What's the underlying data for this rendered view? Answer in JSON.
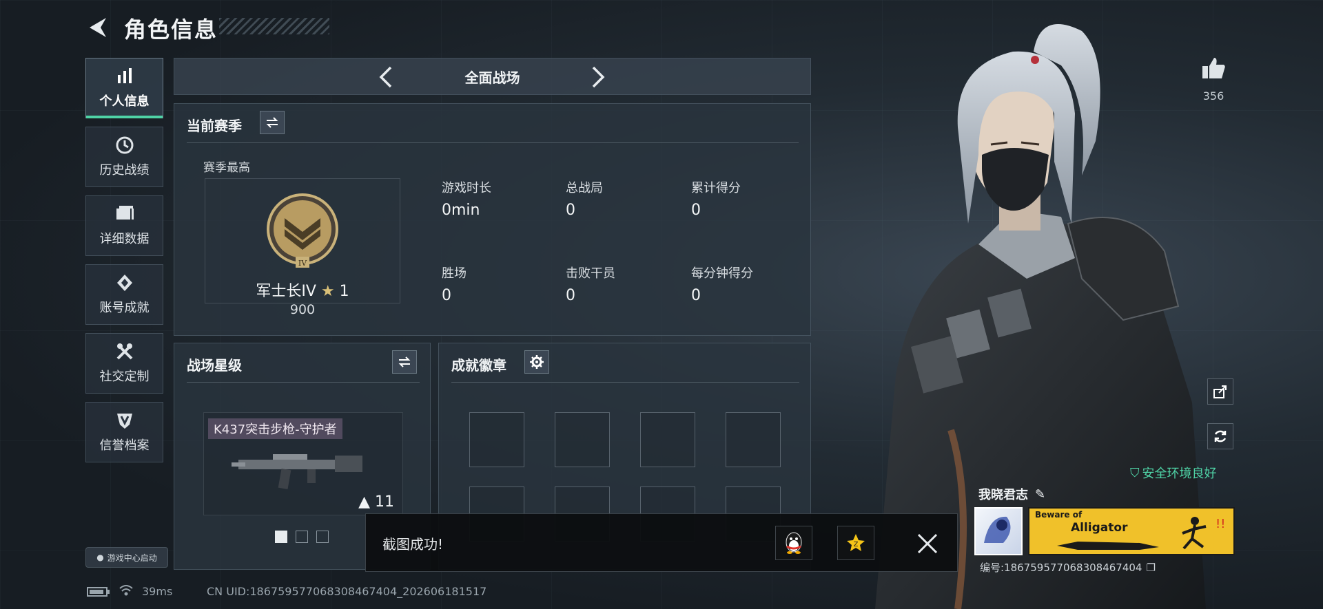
{
  "header": {
    "title": "角色信息"
  },
  "sidebar": {
    "items": [
      {
        "label": "个人信息",
        "icon": "bar-chart-icon",
        "active": true
      },
      {
        "label": "历史战绩",
        "icon": "history-icon",
        "active": false
      },
      {
        "label": "详细数据",
        "icon": "folder-icon",
        "active": false
      },
      {
        "label": "账号成就",
        "icon": "achievement-icon",
        "active": false
      },
      {
        "label": "社交定制",
        "icon": "tools-icon",
        "active": false
      },
      {
        "label": "信誉档案",
        "icon": "shield-icon",
        "active": false
      }
    ],
    "launch_label": "游戏中心启动"
  },
  "mode": {
    "title": "全面战场"
  },
  "season": {
    "title": "当前赛季",
    "best_label": "赛季最高",
    "rank_name": "军士长IV",
    "rank_stars": "1",
    "rank_points": "900",
    "stats": [
      {
        "label": "游戏时长",
        "value": "0min"
      },
      {
        "label": "总战局",
        "value": "0"
      },
      {
        "label": "累计得分",
        "value": "0"
      },
      {
        "label": "胜场",
        "value": "0"
      },
      {
        "label": "击败干员",
        "value": "0"
      },
      {
        "label": "每分钟得分",
        "value": "0"
      }
    ]
  },
  "star_level": {
    "title": "战场星级",
    "weapon_name": "K437突击步枪-守护者",
    "weapon_level": "11"
  },
  "badges": {
    "title": "成就徽章"
  },
  "toast": {
    "text": "截图成功!"
  },
  "status": {
    "ping": "39ms",
    "uid": "CN UID:186759577068308467404_202606181517"
  },
  "profile": {
    "likes": "356",
    "security": "安全环境良好",
    "name": "我晓君志",
    "id": "编号:186759577068308467404",
    "banner_line1": "Beware of",
    "banner_line2": "Alligator"
  },
  "colors": {
    "accent": "#4fd3a6",
    "banner": "#f0c12a"
  }
}
